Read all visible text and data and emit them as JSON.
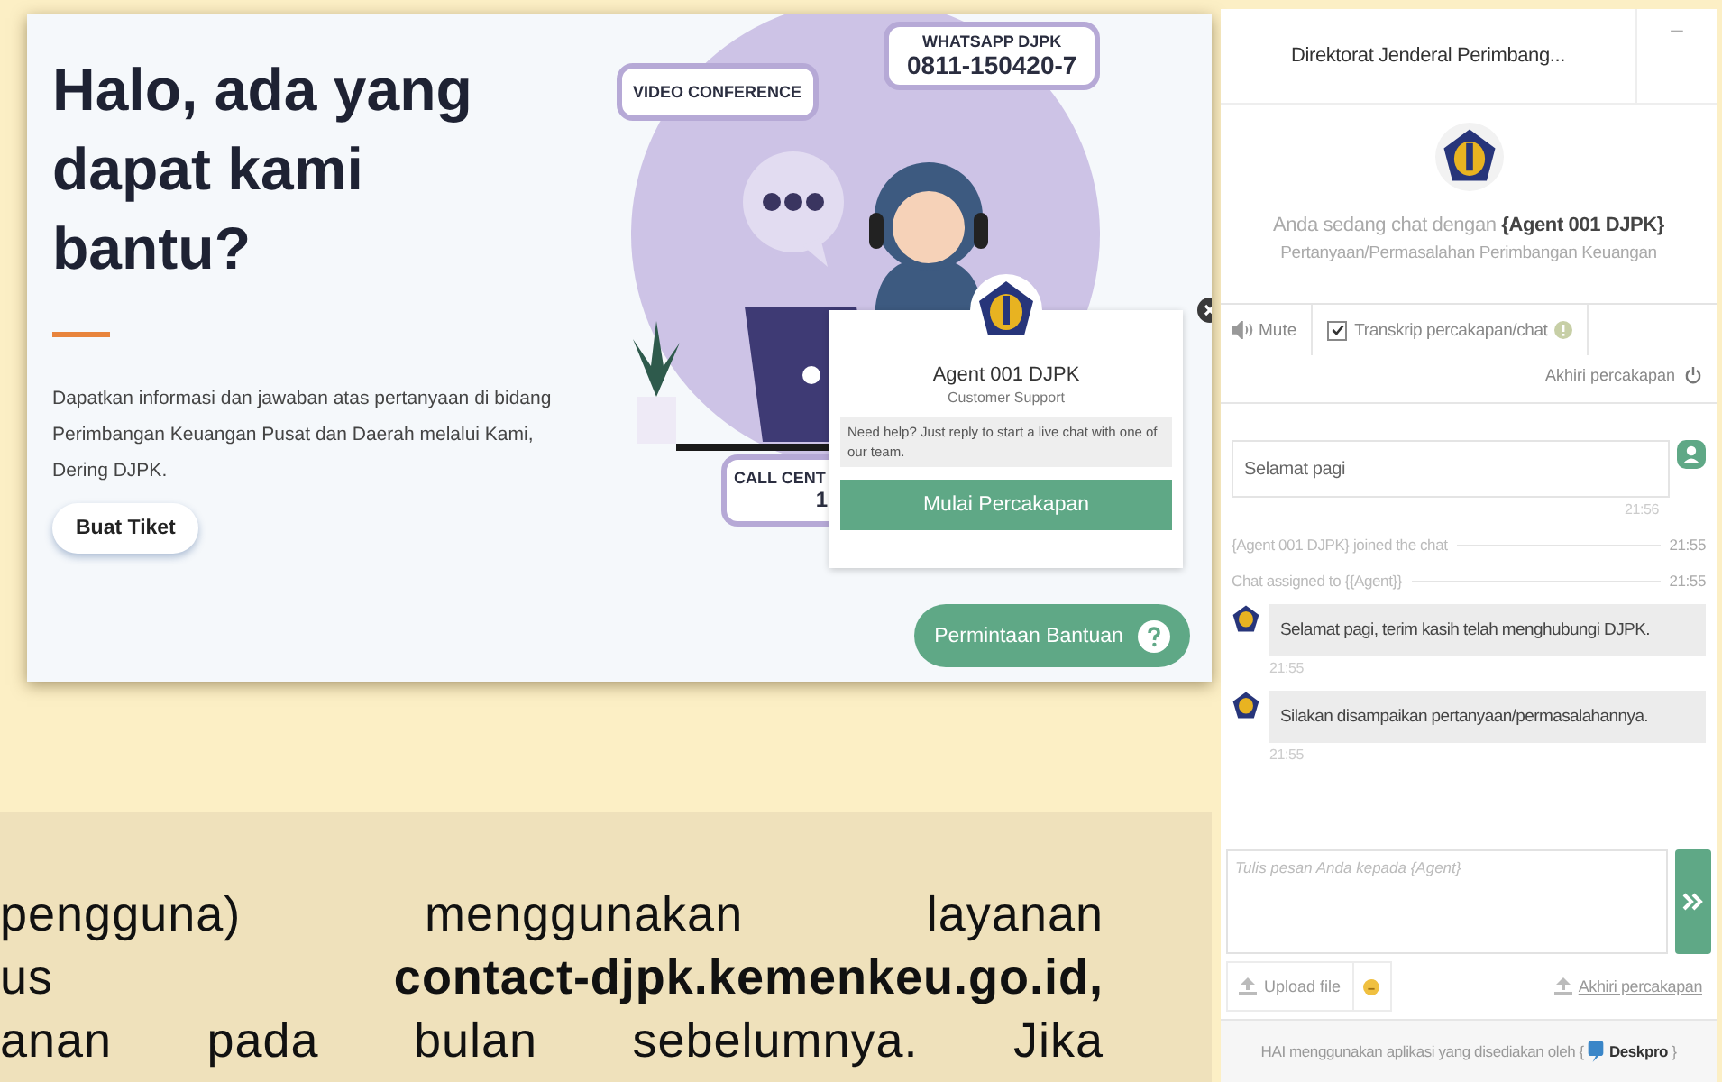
{
  "webpage": {
    "heading_lines": [
      "Halo, ada yang",
      "dapat kami bantu?"
    ],
    "description": "Dapatkan informasi dan jawaban atas pertanyaan di bidang Perimbangan Keuangan Pusat dan Daerah melalui Kami, Dering DJPK.",
    "ticket_button": "Buat Tiket",
    "illustration_labels": [
      {
        "kind": "video",
        "lines": [
          "VIDEO CONFERENCE"
        ]
      },
      {
        "kind": "whatsapp",
        "lines": [
          "WHATSAPP DJPK",
          "0811-150420-7"
        ]
      },
      {
        "kind": "callcenter",
        "lines": [
          "CALL CENT",
          "1"
        ]
      }
    ],
    "popup": {
      "agent": "Agent 001 DJPK",
      "role": "Customer Support",
      "message": "Need help? Just reply to start a live chat with one of our team.",
      "button": "Mulai Percakapan"
    },
    "help_button": "Permintaan Bantuan"
  },
  "chat": {
    "title": "Direktorat Jenderal Perimbang...",
    "minimize": "−",
    "intro": "Anda sedang chat dengan **{Agent 001 DJPK}**",
    "topic": "Pertanyaan/Permasalahan Perimbangan Keuangan",
    "mute": "Mute",
    "transcript": {
      "label": "Transkrip percakapan/chat",
      "checked": true
    },
    "end_chat": "Akhiri percakapan",
    "messages": [
      {
        "kind": "user",
        "text": "Selamat pagi",
        "time": "21:56"
      },
      {
        "kind": "event",
        "text": "{Agent 001 DJPK} joined the chat",
        "time": "21:55"
      },
      {
        "kind": "event",
        "text": "Chat assigned to {{Agent}}",
        "time": "21:55"
      },
      {
        "kind": "agent",
        "text": "Selamat pagi, terim kasih telah menghubungi DJPK.",
        "time": "21:55"
      },
      {
        "kind": "agent",
        "text": "Silakan disampaikan pertanyaan/permasalahannya.",
        "time": "21:55"
      }
    ],
    "input_placeholder": "Tulis pesan Anda kepada {Agent}",
    "upload": "Upload file",
    "end_link": "Akhiri percakapan",
    "footer": {
      "text": "HAI menggunakan aplikasi yang disediakan oleh {",
      "brand": "Deskpro",
      "close": "}"
    }
  },
  "slide_text_lines": [
    "pengguna) menggunakan layanan",
    "us  **contact-djpk.kemenkeu.go.id,**",
    "anan pada bulan sebelumnya. Jika"
  ]
}
